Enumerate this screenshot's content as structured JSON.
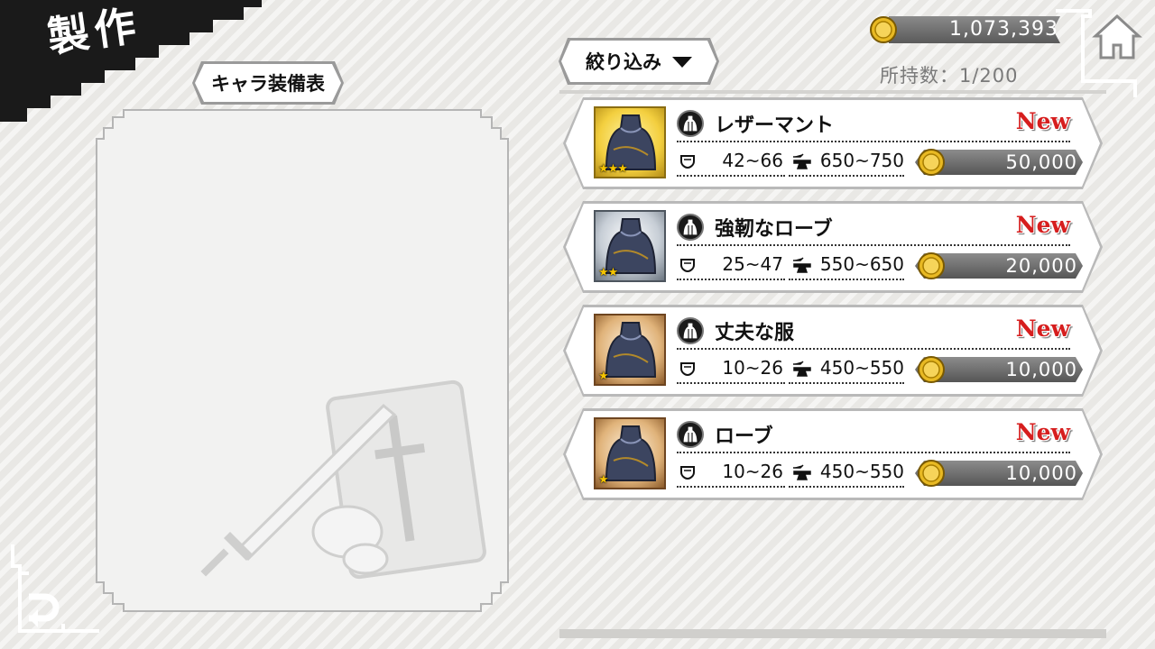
{
  "header": {
    "title": "製作"
  },
  "left": {
    "equip_label": "キャラ装備表"
  },
  "filter": {
    "label": "絞り込み"
  },
  "currency": {
    "gold": "1,073,393"
  },
  "inventory": {
    "owned": "所持数：1/200"
  },
  "icons": {
    "home": "home-icon",
    "back": "back-arrow-icon",
    "coin": "gold-coin-icon",
    "type": "cloak-type-icon",
    "defense": "shield-icon",
    "cost": "anvil-icon",
    "filter": "triangle-down-icon"
  },
  "colors": {
    "new_badge": "#d61e1e",
    "gold_coin": "#e8b923",
    "title_bg": "#1a1a1a"
  },
  "items": [
    {
      "name": "レザーマント",
      "badge": "New",
      "defense": "42~66",
      "craft": "650~750",
      "price": "50,000",
      "stars": "★★★",
      "rarity": "gold"
    },
    {
      "name": "強靭なローブ",
      "badge": "New",
      "defense": "25~47",
      "craft": "550~650",
      "price": "20,000",
      "stars": "★★",
      "rarity": "silver"
    },
    {
      "name": "丈夫な服",
      "badge": "New",
      "defense": "10~26",
      "craft": "450~550",
      "price": "10,000",
      "stars": "★",
      "rarity": "bronze"
    },
    {
      "name": "ローブ",
      "badge": "New",
      "defense": "10~26",
      "craft": "450~550",
      "price": "10,000",
      "stars": "★",
      "rarity": "bronze"
    }
  ]
}
